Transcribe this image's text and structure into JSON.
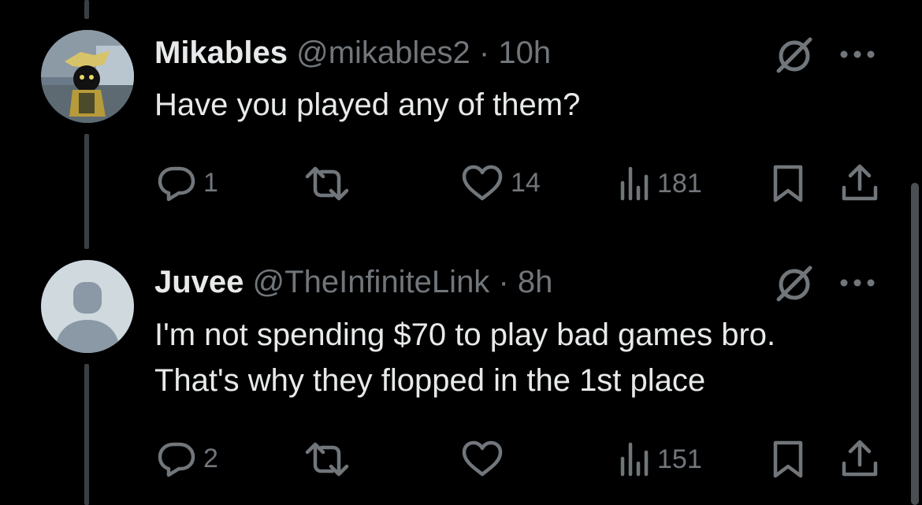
{
  "posts": [
    {
      "display_name": "Mikables",
      "handle": "@mikables2",
      "separator": "·",
      "time": "10h",
      "text_lines": [
        "Have you played any of them?"
      ],
      "actions": {
        "replies": "1",
        "reposts": "",
        "likes": "14",
        "views": "181"
      },
      "avatar_icon": "photo-avatar"
    },
    {
      "display_name": "Juvee",
      "handle": "@TheInfiniteLink",
      "separator": "·",
      "time": "8h",
      "text_lines": [
        "I'm not spending $70 to play bad games bro.",
        "That's why they flopped in the 1st place"
      ],
      "actions": {
        "replies": "2",
        "reposts": "",
        "likes": "",
        "views": "151"
      },
      "avatar_icon": "default-user-avatar"
    }
  ],
  "colors": {
    "background": "#000000",
    "text_primary": "#e7e9ea",
    "text_secondary": "#71767b",
    "thread_line": "#3a3f44"
  },
  "icons": [
    "grok-icon",
    "more-icon",
    "reply-icon",
    "repost-icon",
    "like-icon",
    "views-icon",
    "bookmark-icon",
    "share-icon"
  ]
}
